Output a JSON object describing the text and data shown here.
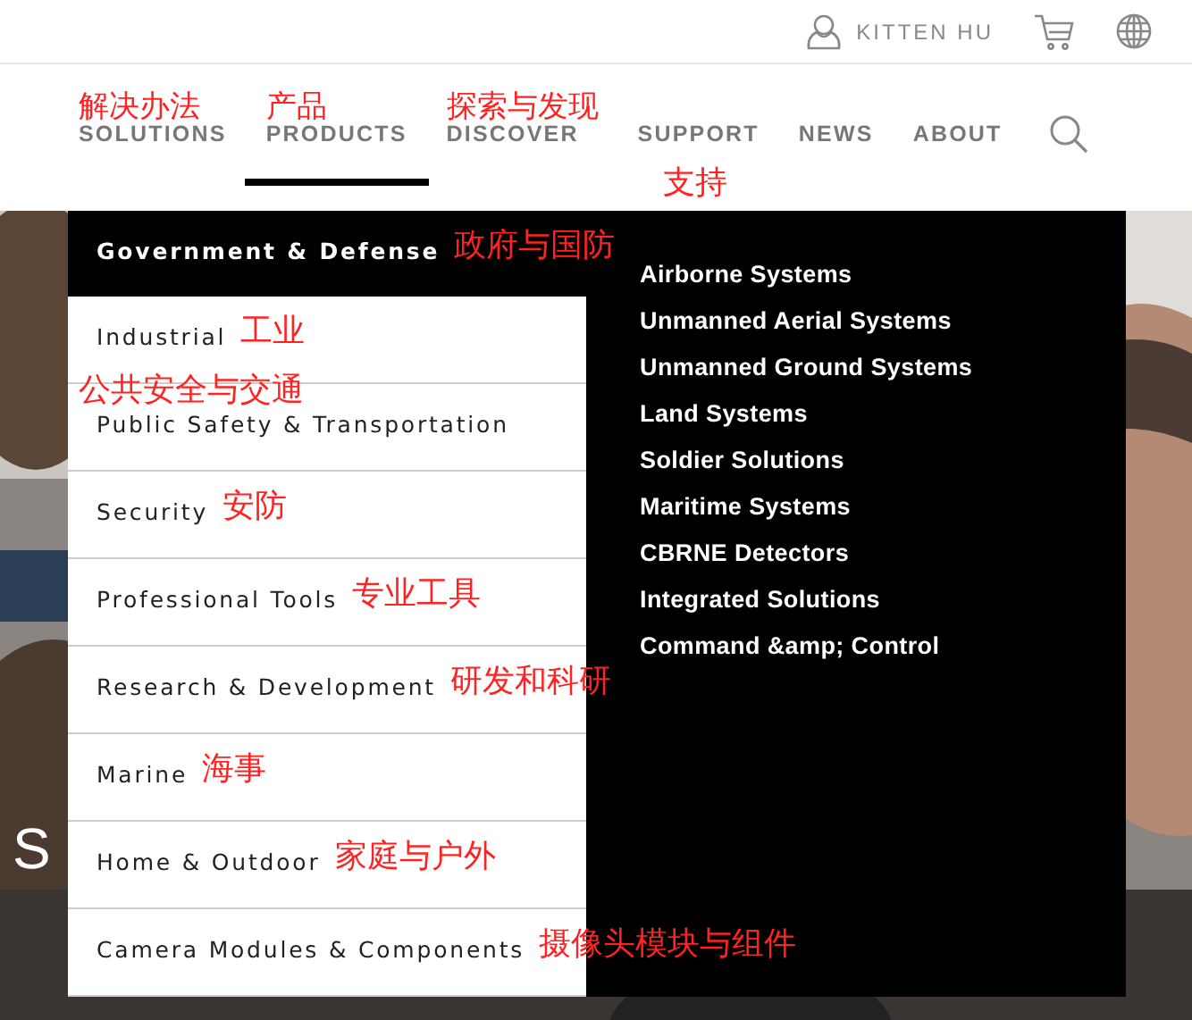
{
  "top_bar": {
    "user_name": "KITTEN HU"
  },
  "nav": [
    {
      "label": "SOLUTIONS",
      "selected": false,
      "note_above": "解决办法"
    },
    {
      "label": "PRODUCTS",
      "selected": true,
      "note_above": "产品"
    },
    {
      "label": "DISCOVER",
      "selected": false,
      "note_above": "探索与发现"
    },
    {
      "label": "SUPPORT",
      "selected": false,
      "note_below": "支持"
    },
    {
      "label": "NEWS",
      "selected": false
    },
    {
      "label": "ABOUT",
      "selected": false
    }
  ],
  "hero": {
    "heading": "S"
  },
  "menu": {
    "categories": [
      {
        "label": "Government & Defense",
        "selected": true,
        "note": "政府与国防"
      },
      {
        "label": "Industrial",
        "selected": false,
        "note": "工业"
      },
      {
        "label": "Public Safety & Transportation",
        "selected": false,
        "note_above": "公共安全与交通"
      },
      {
        "label": "Security",
        "selected": false,
        "note": "安防"
      },
      {
        "label": "Professional Tools",
        "selected": false,
        "note": "专业工具"
      },
      {
        "label": "Research & Development",
        "selected": false,
        "note": "研发和科研"
      },
      {
        "label": "Marine",
        "selected": false,
        "note": "海事"
      },
      {
        "label": "Home & Outdoor",
        "selected": false,
        "note": "家庭与户外"
      },
      {
        "label": "Camera Modules & Components",
        "selected": false,
        "note": "摄像头模块与组件"
      }
    ],
    "links": [
      "Airborne Systems",
      "Unmanned Aerial Systems",
      "Unmanned Ground Systems",
      "Land Systems",
      "Soldier Solutions",
      "Maritime Systems",
      "CBRNE Detectors",
      "Integrated Solutions",
      "Command &amp; Control"
    ]
  }
}
